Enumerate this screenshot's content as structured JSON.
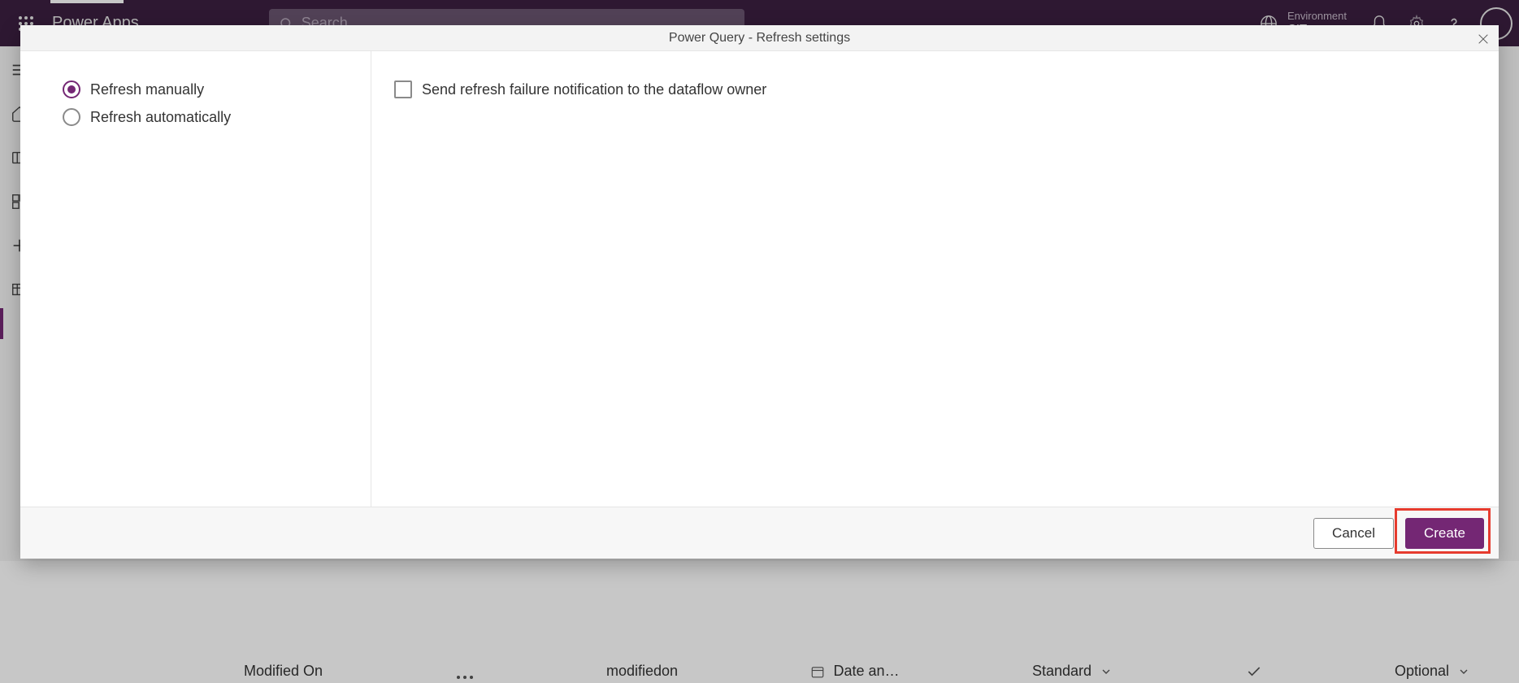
{
  "header": {
    "brand": "Power Apps",
    "search_placeholder": "Search",
    "environment_label": "Environment",
    "environment_value": "CIT"
  },
  "dialog": {
    "title": "Power Query - Refresh settings",
    "radio_manual": "Refresh manually",
    "radio_auto": "Refresh automatically",
    "checkbox_notify": "Send refresh failure notification to the dataflow owner",
    "cancel_label": "Cancel",
    "create_label": "Create"
  },
  "bg_table": {
    "col1": "Modified On",
    "col2": "modifiedon",
    "col3": "Date an…",
    "col4": "Standard",
    "col5": "Optional"
  }
}
